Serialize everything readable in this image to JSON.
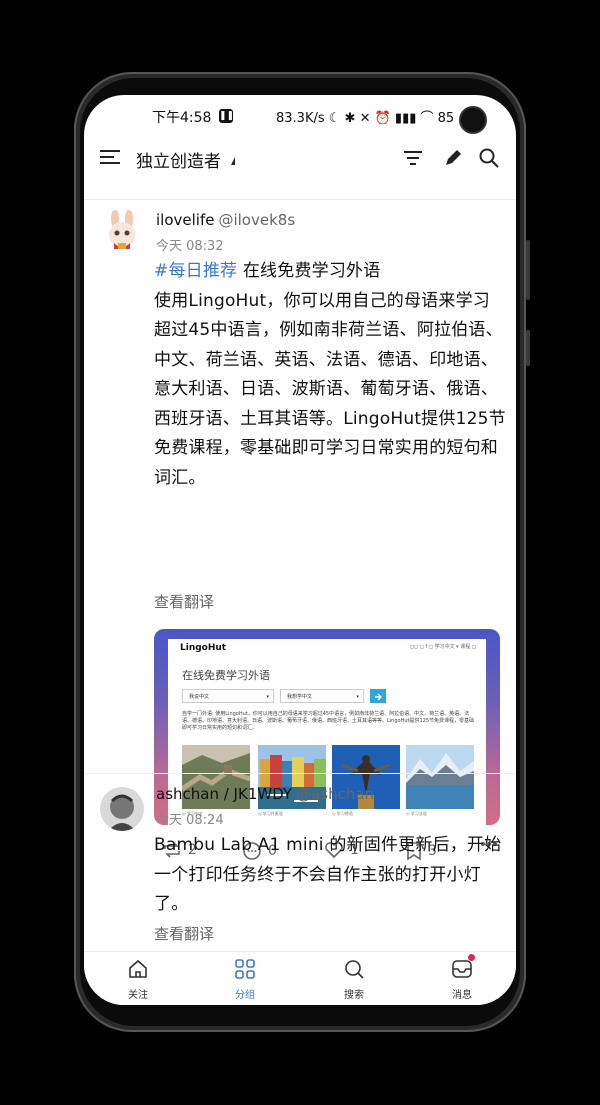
{
  "status_bar": {
    "time": "下午4:58",
    "indicators": "83.3K/s ☾ ✱ ✕ ⏰ ▮▮▮ ⌒ 85"
  },
  "top_bar": {
    "title": "独立创造者",
    "icons": [
      "menu-icon",
      "filter-icon",
      "edit-icon",
      "search-icon"
    ]
  },
  "posts": [
    {
      "user": "ilovelife",
      "handle": "@ilovek8s",
      "time": "今天 08:32",
      "tag": "#每日推荐",
      "text_after_tag": " 在线免费学习外语",
      "text_body": "使用LingoHut，你可以用自己的母语来学习超过45中语言，例如南非荷兰语、阿拉伯语、中文、荷兰语、英语、法语、德语、印地语、意大利语、日语、波斯语、葡萄牙语、俄语、西班牙语、土耳其语等。LingoHut提供125节免费课程，零基础即可学习日常实用的短句和词汇。",
      "translate": "查看翻译",
      "card": {
        "logo": "LingoHut",
        "nav_text": "◻◻ ◻ f ◻  学习中文 ▾   课程  ◻",
        "heading": "在线免费学习外语",
        "select_1": "我说中文",
        "select_2": "我想学中文",
        "paragraph": "自学一门外语: 使用LingoHut，你可以用自己的母语来学习超过45中语言，例如南非荷兰语、阿拉伯语、中文、荷兰语、英语、法语、德语、印地语、意大利语、日语、波斯语、葡萄牙语、俄语、西班牙语、土耳其语等等。LingoHut提供125节免费课程，零基础即可学习日常实用的短句和词汇。",
        "captions": [
          "◎ 学习中文",
          "◎ 学习丹麦语",
          "◎ 学习德语",
          "◎ 学习法语"
        ]
      },
      "actions": {
        "repost": "2",
        "comment": "0",
        "like": "1",
        "bookmark": "3"
      }
    },
    {
      "user": "ashchan / JK1WDY",
      "handle": "@ashchan",
      "time": "今天 08:24",
      "text": "Bambu Lab A1 mini 的新固件更新后，开始一个打印任务终于不会自作主张的打开小灯了。",
      "translate": "查看翻译"
    }
  ],
  "bottom_nav": [
    {
      "label": "关注",
      "icon": "home-icon"
    },
    {
      "label": "分组",
      "icon": "grid-icon"
    },
    {
      "label": "搜索",
      "icon": "search-icon"
    },
    {
      "label": "消息",
      "icon": "inbox-icon"
    }
  ],
  "colors": {
    "accent": "#3a78c9",
    "badge": "#e0245e"
  }
}
